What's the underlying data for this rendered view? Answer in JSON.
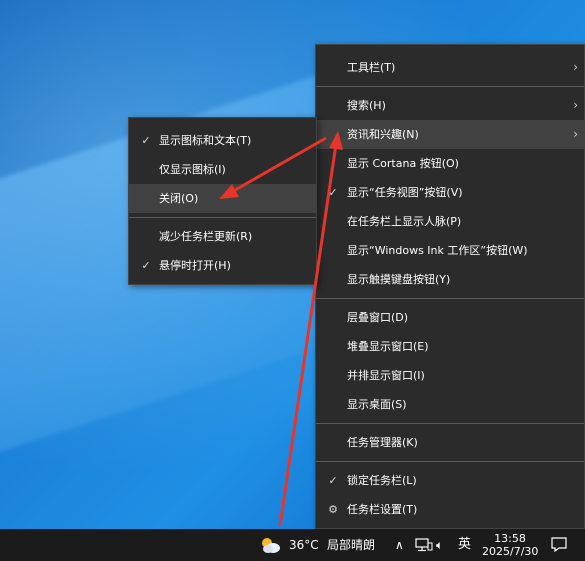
{
  "main_menu": {
    "items": [
      {
        "label": "工具栏(T)",
        "check": "",
        "arrow": "›"
      },
      {
        "label": "搜索(H)",
        "check": "",
        "arrow": "›"
      },
      {
        "label": "资讯和兴趣(N)",
        "check": "",
        "arrow": "›"
      },
      {
        "label": "显示 Cortana 按钮(O)",
        "check": "",
        "arrow": ""
      },
      {
        "label": "显示“任务视图”按钮(V)",
        "check": "✓",
        "arrow": ""
      },
      {
        "label": "在任务栏上显示人脉(P)",
        "check": "",
        "arrow": ""
      },
      {
        "label": "显示“Windows Ink 工作区”按钮(W)",
        "check": "",
        "arrow": ""
      },
      {
        "label": "显示触摸键盘按钮(Y)",
        "check": "",
        "arrow": ""
      },
      {
        "label": "层叠窗口(D)",
        "check": "",
        "arrow": ""
      },
      {
        "label": "堆叠显示窗口(E)",
        "check": "",
        "arrow": ""
      },
      {
        "label": "并排显示窗口(I)",
        "check": "",
        "arrow": ""
      },
      {
        "label": "显示桌面(S)",
        "check": "",
        "arrow": ""
      },
      {
        "label": "任务管理器(K)",
        "check": "",
        "arrow": ""
      },
      {
        "label": "锁定任务栏(L)",
        "check": "✓",
        "arrow": ""
      },
      {
        "label": "任务栏设置(T)",
        "check": "⚙",
        "arrow": ""
      }
    ]
  },
  "sub_menu": {
    "items": [
      {
        "label": "显示图标和文本(T)",
        "check": "✓"
      },
      {
        "label": "仅显示图标(I)",
        "check": ""
      },
      {
        "label": "关闭(O)",
        "check": ""
      },
      {
        "label": "减少任务栏更新(R)",
        "check": ""
      },
      {
        "label": "悬停时打开(H)",
        "check": "✓"
      }
    ]
  },
  "taskbar": {
    "weather_icon": "sun-cloud-icon",
    "temperature": "36°C",
    "weather": "局部晴朗",
    "tray_up": "∧",
    "volume": "🔈︎",
    "ime": "英",
    "time": "13:58",
    "date": "2025/7/30"
  },
  "colors": {
    "menu_bg": "#2b2b2b",
    "menu_highlight": "#414141",
    "taskbar_bg": "#1b1b1b",
    "annotation_arrow": "#e8352b"
  }
}
